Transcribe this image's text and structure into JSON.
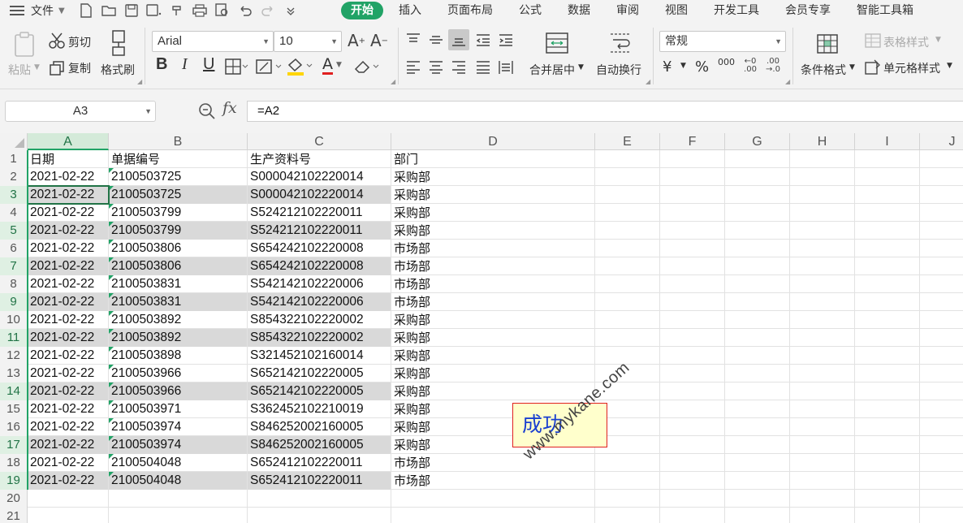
{
  "menubar": {
    "file_label": "文件",
    "tabs": [
      "开始",
      "插入",
      "页面布局",
      "公式",
      "数据",
      "审阅",
      "视图",
      "开发工具",
      "会员专享",
      "智能工具箱"
    ],
    "active_tab": "开始",
    "accent_color": "#21a366"
  },
  "ribbon": {
    "paste": "粘贴",
    "cut": "剪切",
    "copy": "复制",
    "format_painter": "格式刷",
    "font_name": "Arial",
    "font_size": "10",
    "merge_center": "合并居中",
    "wrap_text": "自动换行",
    "number_format": "常规",
    "conditional_format": "条件格式",
    "table_style": "表格样式",
    "cell_style": "单元格样式",
    "bold": "B",
    "italic": "I",
    "underline": "U",
    "font_color_letter": "A",
    "percent": "%",
    "yen": "¥",
    "thousands": "000"
  },
  "formulabar": {
    "name_box": "A3",
    "fx": "fx",
    "formula": "=A2"
  },
  "grid": {
    "columns": [
      "A",
      "B",
      "C",
      "D",
      "E",
      "F",
      "G",
      "H",
      "I",
      "J"
    ],
    "selected_column": "A",
    "row_numbers": [
      "1",
      "2",
      "3",
      "4",
      "5",
      "6",
      "7",
      "8",
      "9",
      "10",
      "11",
      "12",
      "13",
      "14",
      "15",
      "16",
      "17",
      "18",
      "19",
      "20",
      "21"
    ],
    "rows": [
      {
        "a": "日期",
        "b": "单据编号",
        "c": "生产资料号",
        "d": "部门",
        "dup": false
      },
      {
        "a": "2021-02-22",
        "b": "2100503725",
        "c": "S000042102220014",
        "d": "采购部",
        "dup": false
      },
      {
        "a": "2021-02-22",
        "b": "2100503725",
        "c": "S000042102220014",
        "d": "采购部",
        "dup": true
      },
      {
        "a": "2021-02-22",
        "b": "2100503799",
        "c": "S524212102220011",
        "d": "采购部",
        "dup": false
      },
      {
        "a": "2021-02-22",
        "b": "2100503799",
        "c": "S524212102220011",
        "d": "采购部",
        "dup": true
      },
      {
        "a": "2021-02-22",
        "b": "2100503806",
        "c": "S654242102220008",
        "d": "市场部",
        "dup": false
      },
      {
        "a": "2021-02-22",
        "b": "2100503806",
        "c": "S654242102220008",
        "d": "市场部",
        "dup": true
      },
      {
        "a": "2021-02-22",
        "b": "2100503831",
        "c": "S542142102220006",
        "d": "市场部",
        "dup": false
      },
      {
        "a": "2021-02-22",
        "b": "2100503831",
        "c": "S542142102220006",
        "d": "市场部",
        "dup": true
      },
      {
        "a": "2021-02-22",
        "b": "2100503892",
        "c": "S854322102220002",
        "d": "采购部",
        "dup": false
      },
      {
        "a": "2021-02-22",
        "b": "2100503892",
        "c": "S854322102220002",
        "d": "采购部",
        "dup": true
      },
      {
        "a": "2021-02-22",
        "b": "2100503898",
        "c": "S321452102160014",
        "d": "采购部",
        "dup": false
      },
      {
        "a": "2021-02-22",
        "b": "2100503966",
        "c": "S652142102220005",
        "d": "采购部",
        "dup": false
      },
      {
        "a": "2021-02-22",
        "b": "2100503966",
        "c": "S652142102220005",
        "d": "采购部",
        "dup": true
      },
      {
        "a": "2021-02-22",
        "b": "2100503971",
        "c": "S362452102210019",
        "d": "采购部",
        "dup": false
      },
      {
        "a": "2021-02-22",
        "b": "2100503974",
        "c": "S846252002160005",
        "d": "采购部",
        "dup": false
      },
      {
        "a": "2021-02-22",
        "b": "2100503974",
        "c": "S846252002160005",
        "d": "采购部",
        "dup": true
      },
      {
        "a": "2021-02-22",
        "b": "2100504048",
        "c": "S652412102220011",
        "d": "市场部",
        "dup": false
      },
      {
        "a": "2021-02-22",
        "b": "2100504048",
        "c": "S652412102220011",
        "d": "市场部",
        "dup": true
      },
      {
        "a": "",
        "b": "",
        "c": "",
        "d": "",
        "dup": false
      },
      {
        "a": "",
        "b": "",
        "c": "",
        "d": "",
        "dup": false
      }
    ],
    "highlight_color": "#d9d9d9"
  },
  "annotation": {
    "success_text": "成功",
    "watermark": "www.mykane.com"
  }
}
